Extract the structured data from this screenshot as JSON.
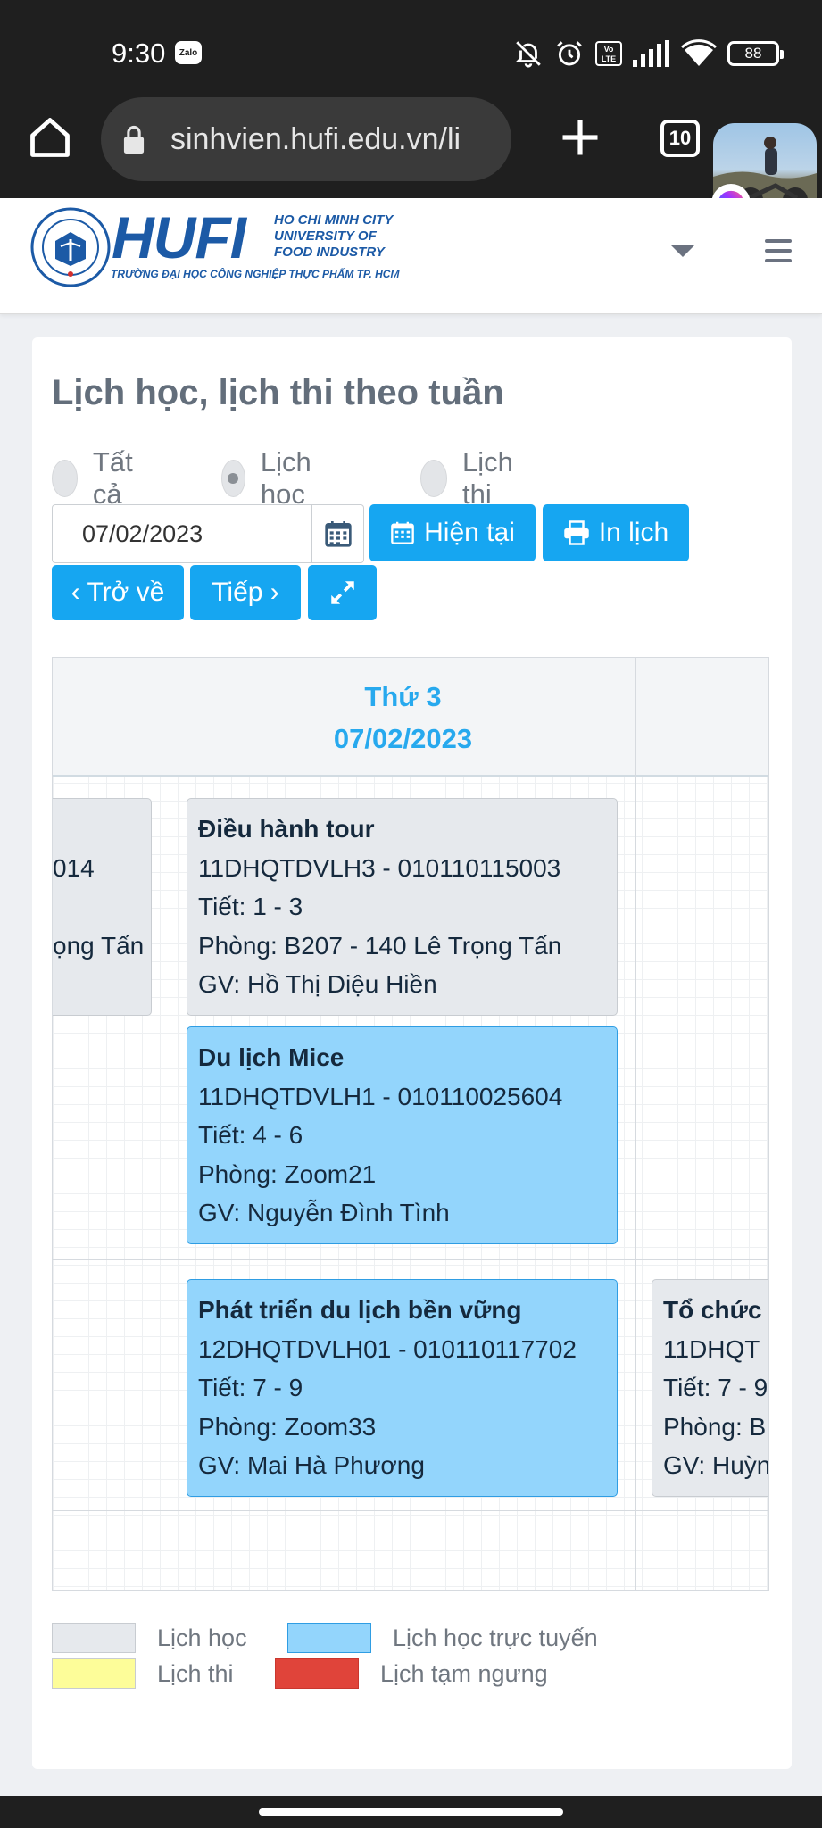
{
  "status_bar": {
    "time": "9:30",
    "notification_app": "Zalo",
    "volte": "Vo LTE",
    "battery": "88",
    "icons": [
      "bell-off-icon",
      "alarm-icon",
      "volte-icon",
      "signal-icon",
      "wifi-icon",
      "battery-icon"
    ]
  },
  "browser": {
    "url": "sinhvien.hufi.edu.vn/li",
    "tab_count": "10",
    "icons": [
      "home-icon",
      "lock-icon",
      "plus-icon",
      "messenger-icon"
    ]
  },
  "header": {
    "logo_name": "HUFI",
    "logo_city": "HO CHI MINH CITY UNIVERSITY OF FOOD INDUSTRY",
    "logo_subtitle": "TRƯỜNG ĐẠI HỌC CÔNG NGHIỆP THỰC PHẨM TP. HCM"
  },
  "page_title": "Lịch học, lịch thi theo tuần",
  "filters": [
    {
      "label": "Tất cả",
      "checked": false
    },
    {
      "label": "Lịch học",
      "checked": true
    },
    {
      "label": "Lịch thi",
      "checked": false
    }
  ],
  "date_value": "07/02/2023",
  "buttons": {
    "current": "Hiện tại",
    "print": "In lịch",
    "back": "‹ Trở về",
    "next": "Tiếp ›"
  },
  "schedule": {
    "day_name": "Thứ 3",
    "day_date": "07/02/2023",
    "left_event": {
      "line1": "014",
      "line2": "ọng Tấn"
    },
    "events": [
      {
        "title": "Điều hành tour",
        "code": "11DHQTDVLH3 - 010110115003",
        "period": "Tiết: 1 - 3",
        "room": "Phòng: B207 - 140 Lê Trọng Tấn",
        "teacher": "GV: Hồ Thị Diệu Hiền",
        "kind": "Lịch học"
      },
      {
        "title": "Du lịch Mice",
        "code": "11DHQTDVLH1 - 010110025604",
        "period": "Tiết: 4 - 6",
        "room": "Phòng: Zoom21",
        "teacher": "GV: Nguyễn Đình Tình",
        "kind": "Lịch học trực tuyến"
      },
      {
        "title": "Phát triển du lịch bền vững",
        "code": "12DHQTDVLH01 - 010110117702",
        "period": "Tiết: 7 - 9",
        "room": "Phòng: Zoom33",
        "teacher": "GV: Mai Hà Phương",
        "kind": "Lịch học trực tuyến"
      }
    ],
    "right_event": {
      "title": "Tổ chức",
      "code": "11DHQT",
      "period": "Tiết: 7 - 9",
      "room": "Phòng: B",
      "teacher": "GV: Huỳn"
    }
  },
  "legend": [
    {
      "label": "Lịch học",
      "color": "#e6e9ed"
    },
    {
      "label": "Lịch học trực tuyến",
      "color": "#93d5fc"
    },
    {
      "label": "Lịch thi",
      "color": "#fdfd99"
    },
    {
      "label": "Lịch tạm ngưng",
      "color": "#e0443a"
    }
  ]
}
